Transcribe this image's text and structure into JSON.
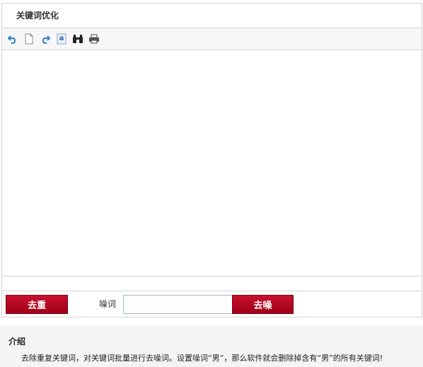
{
  "panel": {
    "title": "关键词优化"
  },
  "toolbar": {
    "items": [
      {
        "name": "undo-icon",
        "color": "#2a7fd4"
      },
      {
        "name": "new-document-icon",
        "color": "#888888"
      },
      {
        "name": "redo-icon",
        "color": "#2a7fd4"
      },
      {
        "name": "text-a-icon",
        "color": "#2a7fd4"
      },
      {
        "name": "binoculars-icon",
        "color": "#222222"
      },
      {
        "name": "printer-icon",
        "color": "#444444"
      }
    ],
    "text_a_glyph": "a"
  },
  "actions": {
    "dedupe_label": "去重",
    "noise_label": "噪词",
    "noise_value": "",
    "denoise_label": "去噪"
  },
  "intro": {
    "title": "介绍",
    "text": "去除重复关键词，对关键词批量进行去噪词。设置噪词“男”，那么软件就会删除掉含有“男”的所有关键词!"
  },
  "colors": {
    "button_red": "#b4001e",
    "border": "#d4d4d4"
  }
}
